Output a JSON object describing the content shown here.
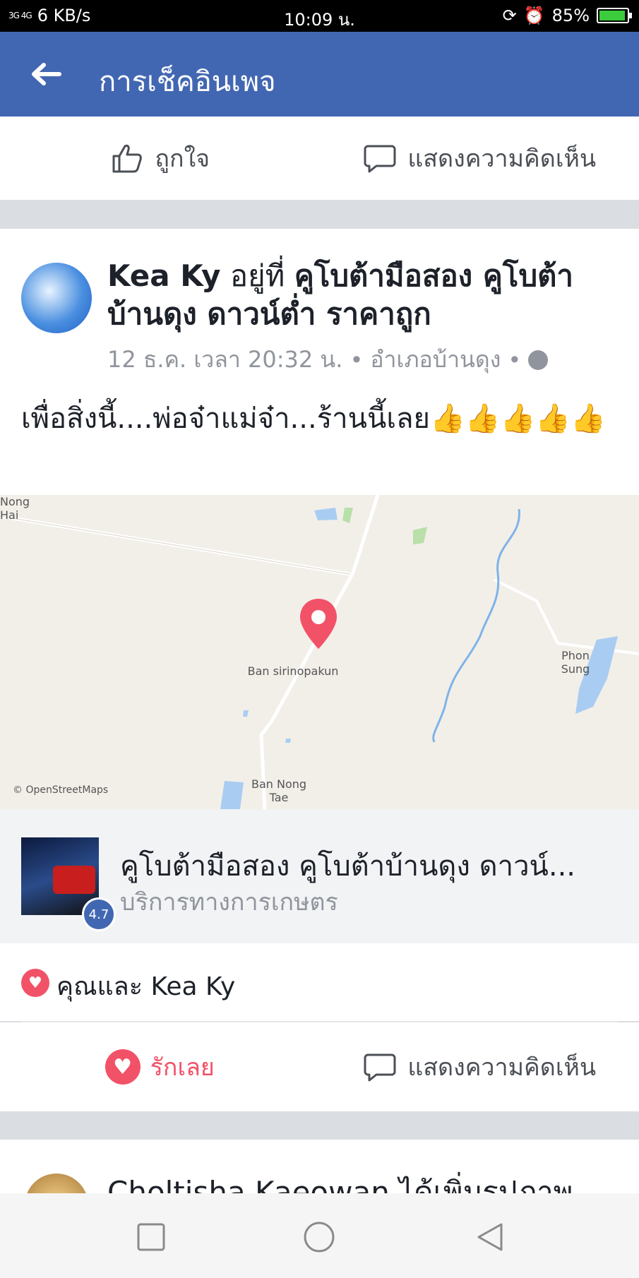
{
  "status": {
    "network": "3G 4G",
    "speed": "6 KB/s",
    "time": "10:09 น.",
    "battery": "85%"
  },
  "appbar": {
    "title": "การเช็คอินเพจ"
  },
  "top_actions": {
    "like": "ถูกใจ",
    "comment": "แสดงความคิดเห็น"
  },
  "post": {
    "author": "Kea Ky",
    "at_text": " อยู่ที่ ",
    "place": "คูโบต้ามือสอง คูโบต้าบ้านดุง ดาวน์ต่ำ ราคาถูก",
    "time": "12 ธ.ค. เวลา 20:32 น.",
    "location": "อำเภอบ้านดุง",
    "dot": "•",
    "text": "เพื่อสิ่งนี้....พ่อจ๋าแม่จ๋า...ร้านนี้เลย👍👍👍👍👍"
  },
  "map": {
    "labels": {
      "nong_hai_1": "Nong",
      "nong_hai_2": "Hai",
      "pin": "Ban sirinopakun",
      "phon_1": "Phon",
      "phon_2": "Sung",
      "tae_1": "Ban Nong",
      "tae_2": "Tae",
      "credit": "© OpenStreetMaps"
    }
  },
  "place_card": {
    "name": "คูโบต้ามือสอง คูโบต้าบ้านดุง ดาวน์...",
    "category": "บริการทางการเกษตร",
    "rating": "4.7"
  },
  "reactions": {
    "who": "คุณและ Kea Ky"
  },
  "bottom_actions": {
    "love": "รักเลย",
    "comment": "แสดงความคิดเห็น"
  },
  "next_post": {
    "text": "Choltisha Kaeowan ได้เพิ่มรูปภาพ"
  }
}
